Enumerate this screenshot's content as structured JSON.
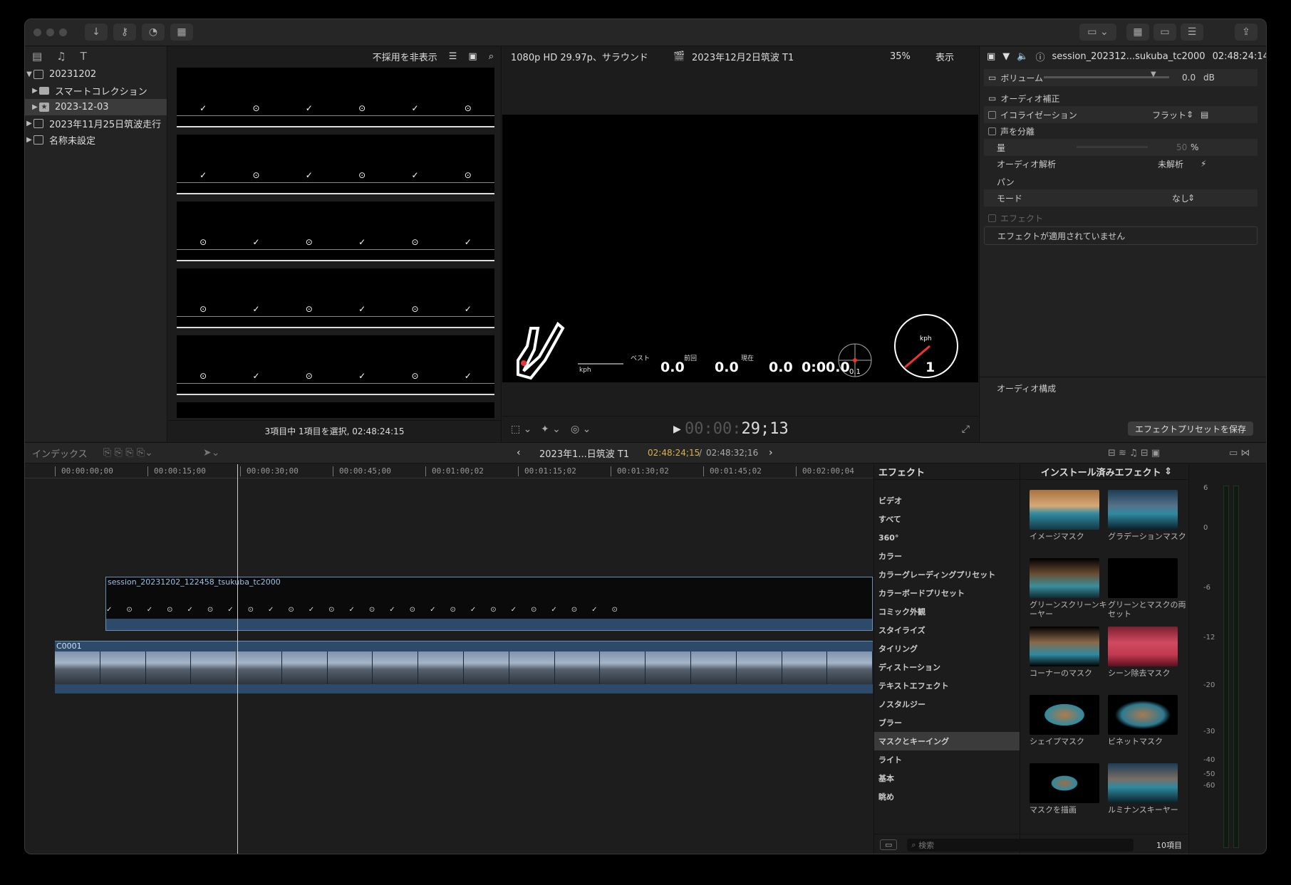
{
  "browser": {
    "filter_label": "不採用を非表示",
    "libraries": [
      {
        "label": "20231202",
        "expanded": true
      },
      {
        "label": "スマートコレクション"
      },
      {
        "label": "2023-12-03",
        "selected": true
      },
      {
        "label": "2023年11月25日筑波走行"
      },
      {
        "label": "名称未設定"
      }
    ],
    "status": "3項目中 1項目を選択, 02:48:24:15"
  },
  "viewer": {
    "format": "1080p HD 29.97p、サラウンド",
    "title": "2023年12月2日筑波 T1",
    "zoom": "35%",
    "view_label": "表示",
    "timecode_dim": "00:00:",
    "timecode": "29;13",
    "overlay": {
      "speed_unit": "kph",
      "best_label": "ベスト",
      "prev_label": "前回",
      "now_label": "現在",
      "best_value": "0.0",
      "prev_value": "0.0",
      "now_value": "0.0",
      "time_value": "0:00.0",
      "gauge_unit": "kph",
      "gauge_value": "1",
      "g_value": "0.1"
    }
  },
  "inspector": {
    "clip_name": "session_202312...sukuba_tc2000",
    "duration": "02:48:24:14",
    "volume_label": "ボリューム",
    "volume_value": "0.0",
    "volume_unit": "dB",
    "audio_enhance": "オーディオ補正",
    "equalization": "イコライゼーション",
    "eq_value": "フラット",
    "voice_iso": "声を分離",
    "amount": "量",
    "amount_value": "50",
    "amount_unit": "%",
    "analysis": "オーディオ解析",
    "analysis_value": "未解析",
    "pan": "パン",
    "mode": "モード",
    "mode_value": "なし",
    "effects_label": "エフェクト",
    "no_effects": "エフェクトが適用されていません",
    "audio_config": "オーディオ構成",
    "save_preset": "エフェクトプリセットを保存"
  },
  "timeline_bar": {
    "index": "インデックス",
    "project": "2023年1...日筑波 T1",
    "tc_current": "02:48:24;15",
    "tc_total": "02:48:32;16"
  },
  "timeline": {
    "ruler": [
      "00:00:00;00",
      "00:00:15;00",
      "00:00:30;00",
      "00:00:45;00",
      "00:01:00;02",
      "00:01:15;02",
      "00:01:30;02",
      "00:01:45;02",
      "00:02:00;04"
    ],
    "connected_clip": "session_20231202_122458_tsukuba_tc2000",
    "main_clip": "C0001"
  },
  "effects": {
    "title": "エフェクト",
    "installed": "インストール済みエフェクト",
    "categories": [
      "ビデオ",
      "すべて",
      "360°",
      "カラー",
      "カラーグレーディングプリセット",
      "カラーボードプリセット",
      "コミック外観",
      "スタイライズ",
      "タイリング",
      "ディストーション",
      "テキストエフェクト",
      "ノスタルジー",
      "ブラー",
      "マスクとキーイング",
      "ライト",
      "基本",
      "眺め"
    ],
    "selected_category": "マスクとキーイング",
    "items": [
      "イメージマスク",
      "グラデーションマスク",
      "グリーンスクリーンキーヤー",
      "グリーンとマスクの両セット",
      "コーナーのマスク",
      "シーン除去マスク",
      "シェイプマスク",
      "ビネットマスク",
      "マスクを描画",
      "ルミナンスキーヤー"
    ],
    "search_placeholder": "検索",
    "count": "10項目"
  },
  "meters": {
    "labels": [
      "6",
      "0",
      "-6",
      "-12",
      "-20",
      "-30",
      "-40",
      "-50",
      "-60"
    ]
  },
  "colors": {
    "accent_blue": "#6a8fb5",
    "timecode_yellow": "#d9b44a",
    "selected_bg": "#3b3b3b"
  }
}
